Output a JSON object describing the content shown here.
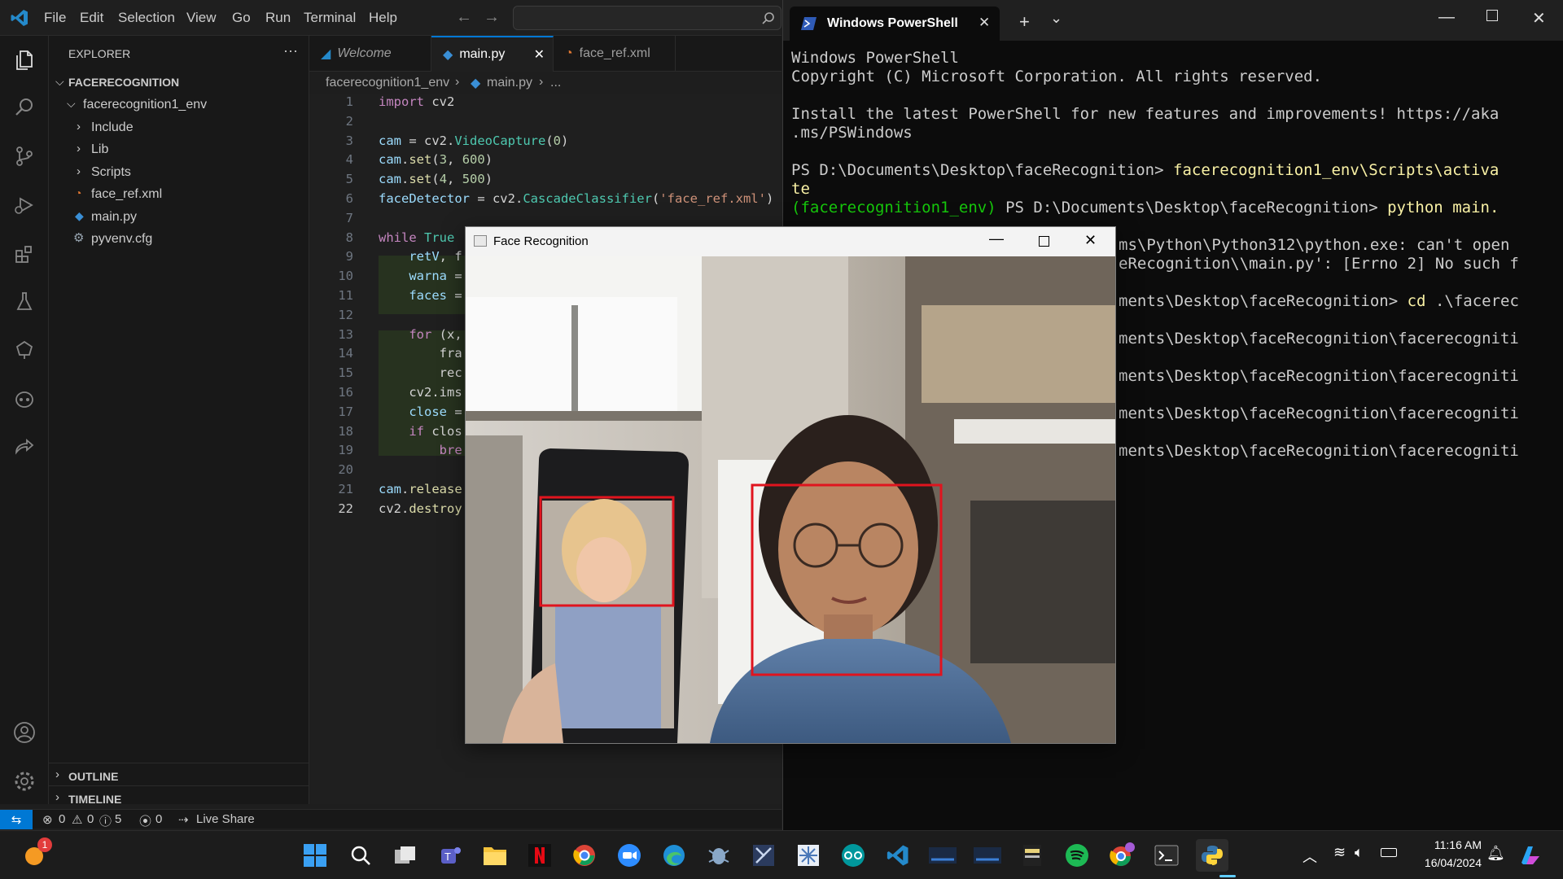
{
  "vscode": {
    "menu": [
      "File",
      "Edit",
      "Selection",
      "View",
      "Go",
      "Run",
      "Terminal",
      "Help"
    ],
    "explorer_title": "EXPLORER",
    "project": "FACERECOGNITION",
    "tree": [
      {
        "label": "facerecognition1_env",
        "type": "folder-open"
      },
      {
        "label": "Include",
        "type": "folder"
      },
      {
        "label": "Lib",
        "type": "folder"
      },
      {
        "label": "Scripts",
        "type": "folder"
      },
      {
        "label": "face_ref.xml",
        "type": "xml"
      },
      {
        "label": "main.py",
        "type": "python"
      },
      {
        "label": "pyvenv.cfg",
        "type": "cfg"
      }
    ],
    "outline": "OUTLINE",
    "timeline": "TIMELINE",
    "tabs": [
      {
        "label": "Welcome",
        "active": false
      },
      {
        "label": "main.py",
        "active": true
      },
      {
        "label": "face_ref.xml",
        "active": false
      }
    ],
    "breadcrumb": {
      "folder": "facerecognition1_env",
      "file": "main.py",
      "more": "..."
    },
    "line_numbers": [
      "1",
      "2",
      "3",
      "4",
      "5",
      "6",
      "7",
      "8",
      "9",
      "10",
      "11",
      "12",
      "13",
      "14",
      "15",
      "16",
      "17",
      "18",
      "19",
      "20",
      "21",
      "22"
    ],
    "status": {
      "errors": "0",
      "warnings": "0",
      "info": "5",
      "ports": "0",
      "live_share": "Live Share"
    }
  },
  "powershell": {
    "tab_title": "Windows PowerShell",
    "lines": [
      "Windows PowerShell",
      "Copyright (C) Microsoft Corporation. All rights reserved.",
      "",
      "Install the latest PowerShell for new features and improvements! https://aka",
      ".ms/PSWindows",
      "",
      "PS D:\\Documents\\Desktop\\faceRecognition> ",
      "te",
      "(facerecognition1_env) PS D:\\Documents\\Desktop\\faceRecognition> ",
      "",
      "ms\\Python\\Python312\\python.exe: can't open",
      "eRecognition\\\\main.py': [Errno 2] No such f",
      "",
      "ments\\Desktop\\faceRecognition> cd .\\facerec",
      "",
      "ments\\Desktop\\faceRecognition\\facerecogniti",
      "",
      "ments\\Desktop\\faceRecognition\\facerecogniti",
      "",
      "ments\\Desktop\\faceRecognition\\facerecogniti",
      "",
      "ments\\Desktop\\faceRecognition\\facerecogniti"
    ],
    "cmd_activate": "facerecognition1_env\\Scripts\\activa",
    "cmd_python_kw": "python",
    "cmd_python_arg": "main.",
    "cmd_cd": "cd"
  },
  "face_window": {
    "title": "Face Recognition"
  },
  "clock": {
    "time": "11:16 AM",
    "date": "16/04/2024"
  },
  "notification_badge": "1",
  "colors": {
    "accent": "#0078d4",
    "detection_box": "#e0141e"
  }
}
